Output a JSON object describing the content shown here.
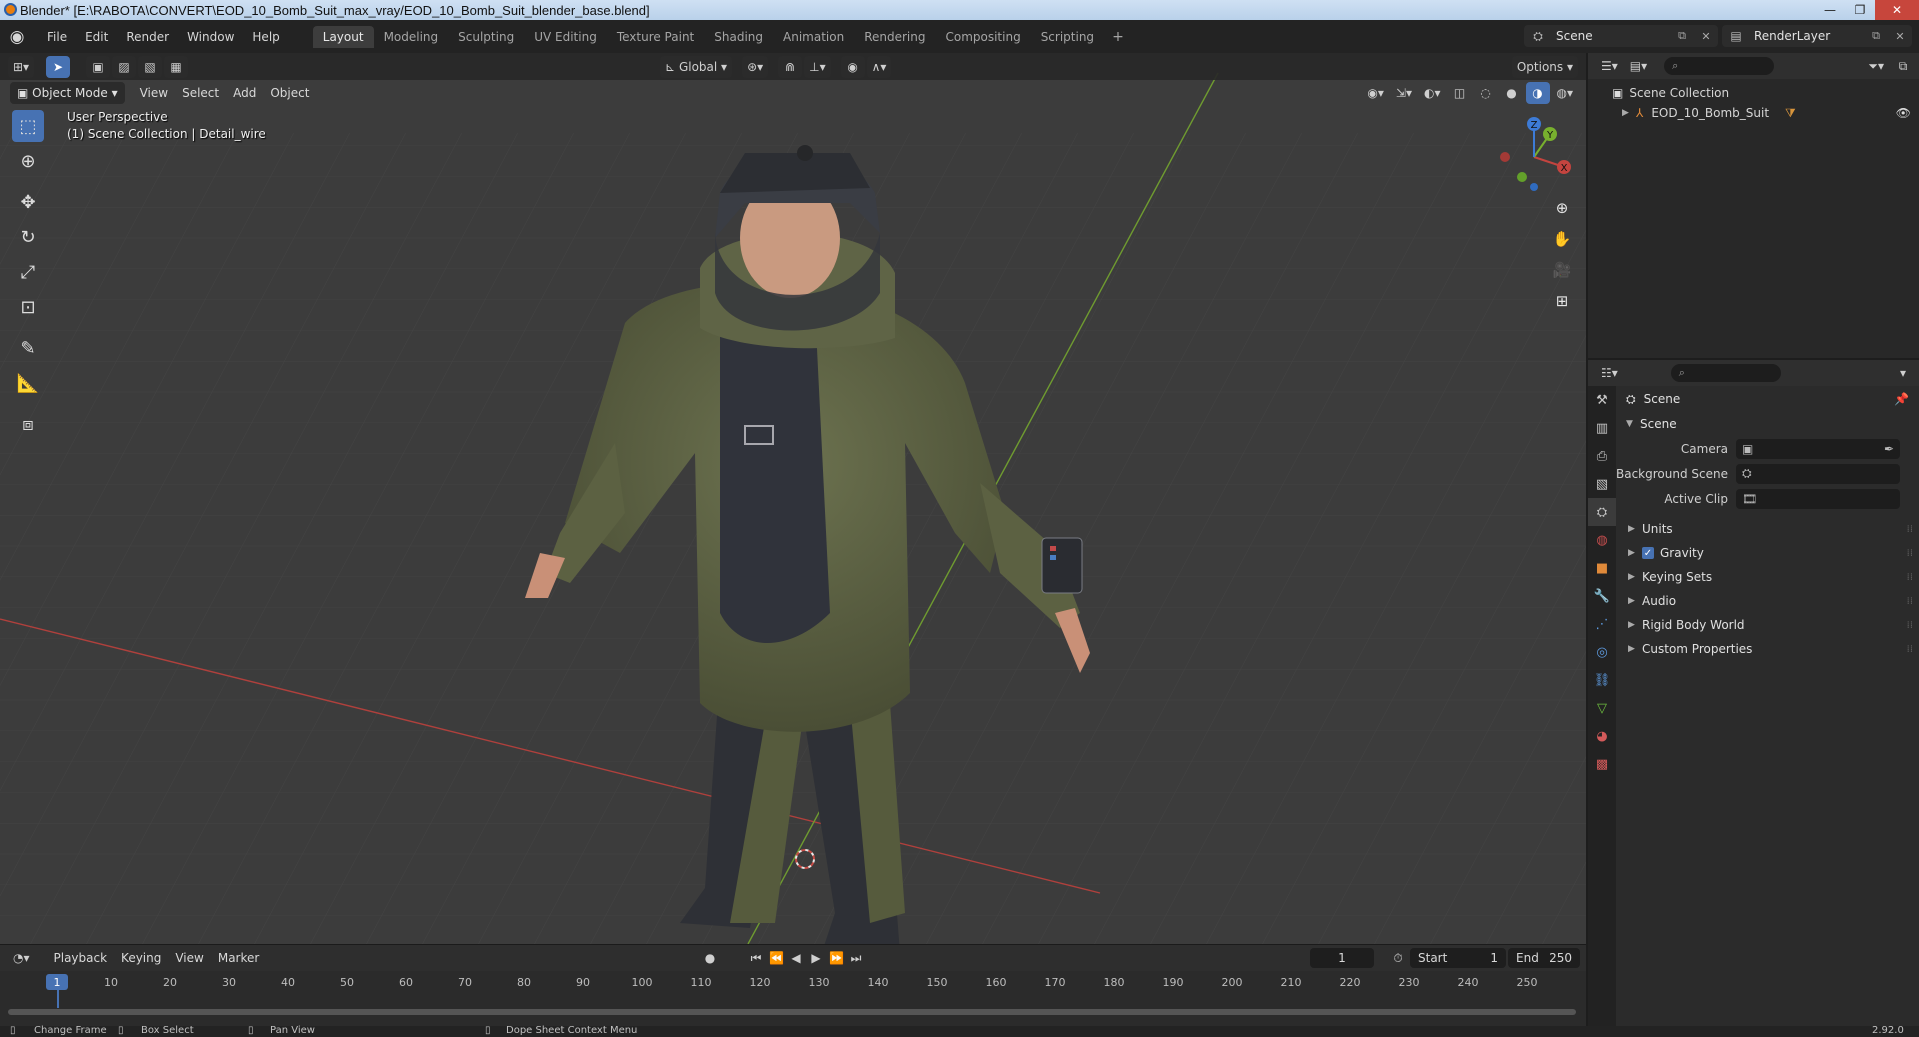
{
  "window": {
    "title": "Blender* [E:\\RABOTA\\CONVERT\\EOD_10_Bomb_Suit_max_vray/EOD_10_Bomb_Suit_blender_base.blend]",
    "buttons": [
      "—",
      "❐",
      "✕"
    ]
  },
  "menu": [
    "File",
    "Edit",
    "Render",
    "Window",
    "Help"
  ],
  "workspaces": {
    "tabs": [
      "Layout",
      "Modeling",
      "Sculpting",
      "UV Editing",
      "Texture Paint",
      "Shading",
      "Animation",
      "Rendering",
      "Compositing",
      "Scripting"
    ],
    "active": "Layout",
    "add": "+"
  },
  "scene_selector": {
    "value": "Scene"
  },
  "layer_selector": {
    "value": "RenderLayer"
  },
  "viewport": {
    "transform_orientation": "Global",
    "options_label": "Options",
    "mode": "Object Mode",
    "header_menus": [
      "View",
      "Select",
      "Add",
      "Object"
    ],
    "perspective_label": "User Perspective",
    "collection_label": "(1) Scene Collection | Detail_wire",
    "gizmo_axes": {
      "x": "X",
      "y": "Y",
      "z": "Z"
    }
  },
  "timeline": {
    "menus": [
      "Playback",
      "Keying",
      "View",
      "Marker"
    ],
    "current_frame": "1",
    "start_label": "Start",
    "start": "1",
    "end_label": "End",
    "end": "250",
    "ticks": [
      "10",
      "20",
      "30",
      "40",
      "50",
      "60",
      "70",
      "80",
      "90",
      "100",
      "110",
      "120",
      "130",
      "140",
      "150",
      "160",
      "170",
      "180",
      "190",
      "200",
      "210",
      "220",
      "230",
      "240",
      "250"
    ],
    "cursor_label": "1"
  },
  "statusbar": {
    "items": [
      "Change Frame",
      "Box Select",
      "Pan View",
      "Dope Sheet Context Menu"
    ],
    "version": "2.92.0"
  },
  "outliner": {
    "root": "Scene Collection",
    "items": [
      {
        "name": "EOD_10_Bomb_Suit"
      }
    ]
  },
  "properties": {
    "context": "Scene",
    "panel": "Scene",
    "fields": [
      {
        "label": "Camera",
        "value": ""
      },
      {
        "label": "Background Scene",
        "value": ""
      },
      {
        "label": "Active Clip",
        "value": ""
      }
    ],
    "subpanels": [
      "Units",
      "Gravity",
      "Keying Sets",
      "Audio",
      "Rigid Body World",
      "Custom Properties"
    ],
    "gravity_checked": true
  },
  "colors": {
    "accent": "#4772b3",
    "axis_x": "#c4443f",
    "axis_y": "#78b02e",
    "axis_z": "#3d7bd6",
    "viewport_bg": "#3c3c3c",
    "suit_olive": "#5e6443",
    "suit_dark": "#33363d"
  },
  "icons": [
    "blender-logo-icon",
    "select-box-icon",
    "cursor-icon",
    "move-icon",
    "rotate-icon",
    "scale-icon",
    "transform-icon",
    "annotate-icon",
    "measure-icon",
    "add-cube-icon",
    "zoom-icon",
    "hand-icon",
    "camera-icon",
    "grid-icon",
    "eye-icon",
    "search-icon",
    "filter-icon",
    "play-icon"
  ]
}
